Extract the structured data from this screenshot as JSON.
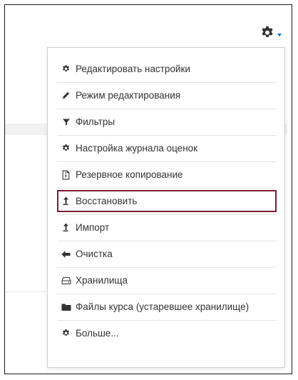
{
  "header": {
    "settings_icon": "gear-icon",
    "caret_icon": "caret-down-icon",
    "accent_color": "#0f6cbf"
  },
  "menu": {
    "items": [
      {
        "label": "Редактировать настройки",
        "icon": "gear-icon"
      },
      {
        "label": "Режим редактирования",
        "icon": "pencil-icon"
      },
      {
        "label": "Фильтры",
        "icon": "filter-icon"
      },
      {
        "label": "Настройка журнала оценок",
        "icon": "gear-icon"
      },
      {
        "label": "Резервное копирование",
        "icon": "file-archive-icon"
      },
      {
        "label": "Восстановить",
        "icon": "upload-arrow-icon",
        "highlighted": true
      },
      {
        "label": "Импорт",
        "icon": "upload-arrow-icon"
      },
      {
        "label": "Очистка",
        "icon": "arrow-left-icon"
      },
      {
        "label": "Хранилища",
        "icon": "drive-icon"
      },
      {
        "label": "Файлы курса (устаревшее хранилище)",
        "icon": "folder-icon"
      },
      {
        "label": "Больше...",
        "icon": "gear-icon"
      }
    ],
    "highlight_color": "#7a1f35"
  }
}
